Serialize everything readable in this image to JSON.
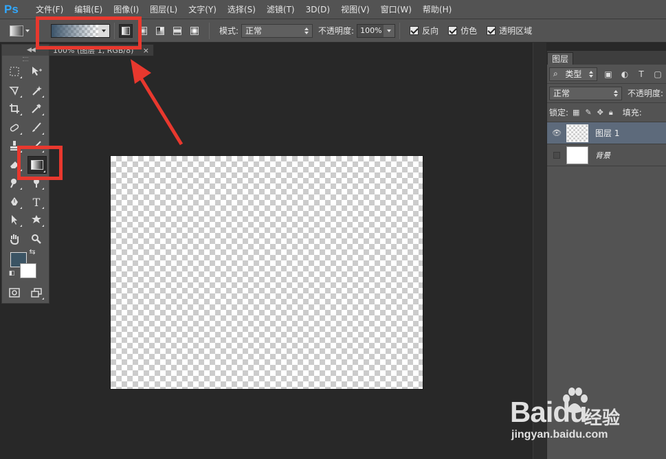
{
  "app": {
    "logo": "Ps"
  },
  "menu": [
    "文件(F)",
    "编辑(E)",
    "图像(I)",
    "图层(L)",
    "文字(Y)",
    "选择(S)",
    "滤镜(T)",
    "3D(D)",
    "视图(V)",
    "窗口(W)",
    "帮助(H)"
  ],
  "options": {
    "mode_label": "模式:",
    "mode_value": "正常",
    "opacity_label": "不透明度:",
    "opacity_value": "100%",
    "reverse_label": "反向",
    "dither_label": "仿色",
    "transparency_label": "透明区域"
  },
  "document": {
    "tab_title": "100% (图层 1, RGB/8)",
    "close": "×"
  },
  "colors": {
    "foreground": "#3b5464",
    "background": "#ffffff",
    "annotation": "#e8382e"
  },
  "layers_panel": {
    "tab": "图层",
    "filter_value": "类型",
    "blend_value": "正常",
    "opacity_label": "不透明度:",
    "lock_label": "锁定:",
    "fill_label": "填充:",
    "layers": [
      {
        "name": "图层 1",
        "selected": true,
        "visible": true
      },
      {
        "name": "背景",
        "selected": false,
        "visible": false
      }
    ]
  },
  "watermark": {
    "brand": "Baidu",
    "cn": "经验",
    "url": "jingyan.baidu.com"
  }
}
